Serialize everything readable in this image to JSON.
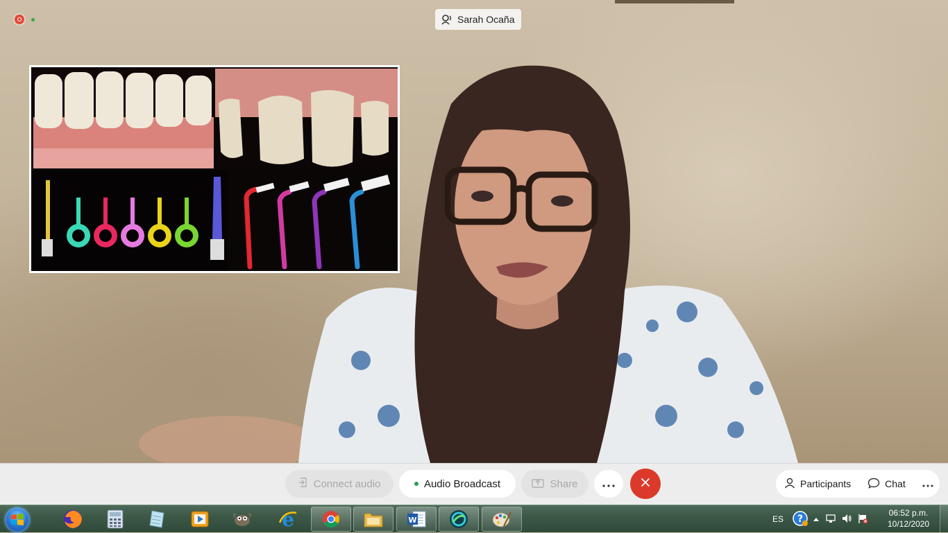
{
  "window": {
    "speaker_name": "Sarah Ocaña",
    "recording_indicator": "recording-icon",
    "connection_indicator": "connection-dot-icon"
  },
  "shared_content": {
    "type": "slide",
    "panels": [
      "teeth-lower-photo",
      "teeth-upper-photo",
      "interdental-brushes-photo",
      "angled-interdental-brushes-photo"
    ]
  },
  "controls": {
    "connect_audio_label": "Connect audio",
    "audio_broadcast_label": "Audio Broadcast",
    "share_label": "Share",
    "more_icon": "ellipsis-icon",
    "end_icon": "close-icon",
    "participants_label": "Participants",
    "chat_label": "Chat",
    "panel_more_icon": "ellipsis-icon",
    "colors": {
      "end_button": "#db3a2b",
      "active_dot": "#2a9d57"
    }
  },
  "taskbar": {
    "apps": [
      "firefox-icon",
      "calculator-icon",
      "notepad-icon",
      "media-player-icon",
      "gimp-icon",
      "internet-explorer-icon",
      "chrome-icon",
      "file-explorer-icon",
      "word-icon",
      "webex-icon",
      "paint-icon"
    ],
    "language": "ES",
    "time": "06:52 p.m.",
    "date": "10/12/2020"
  }
}
